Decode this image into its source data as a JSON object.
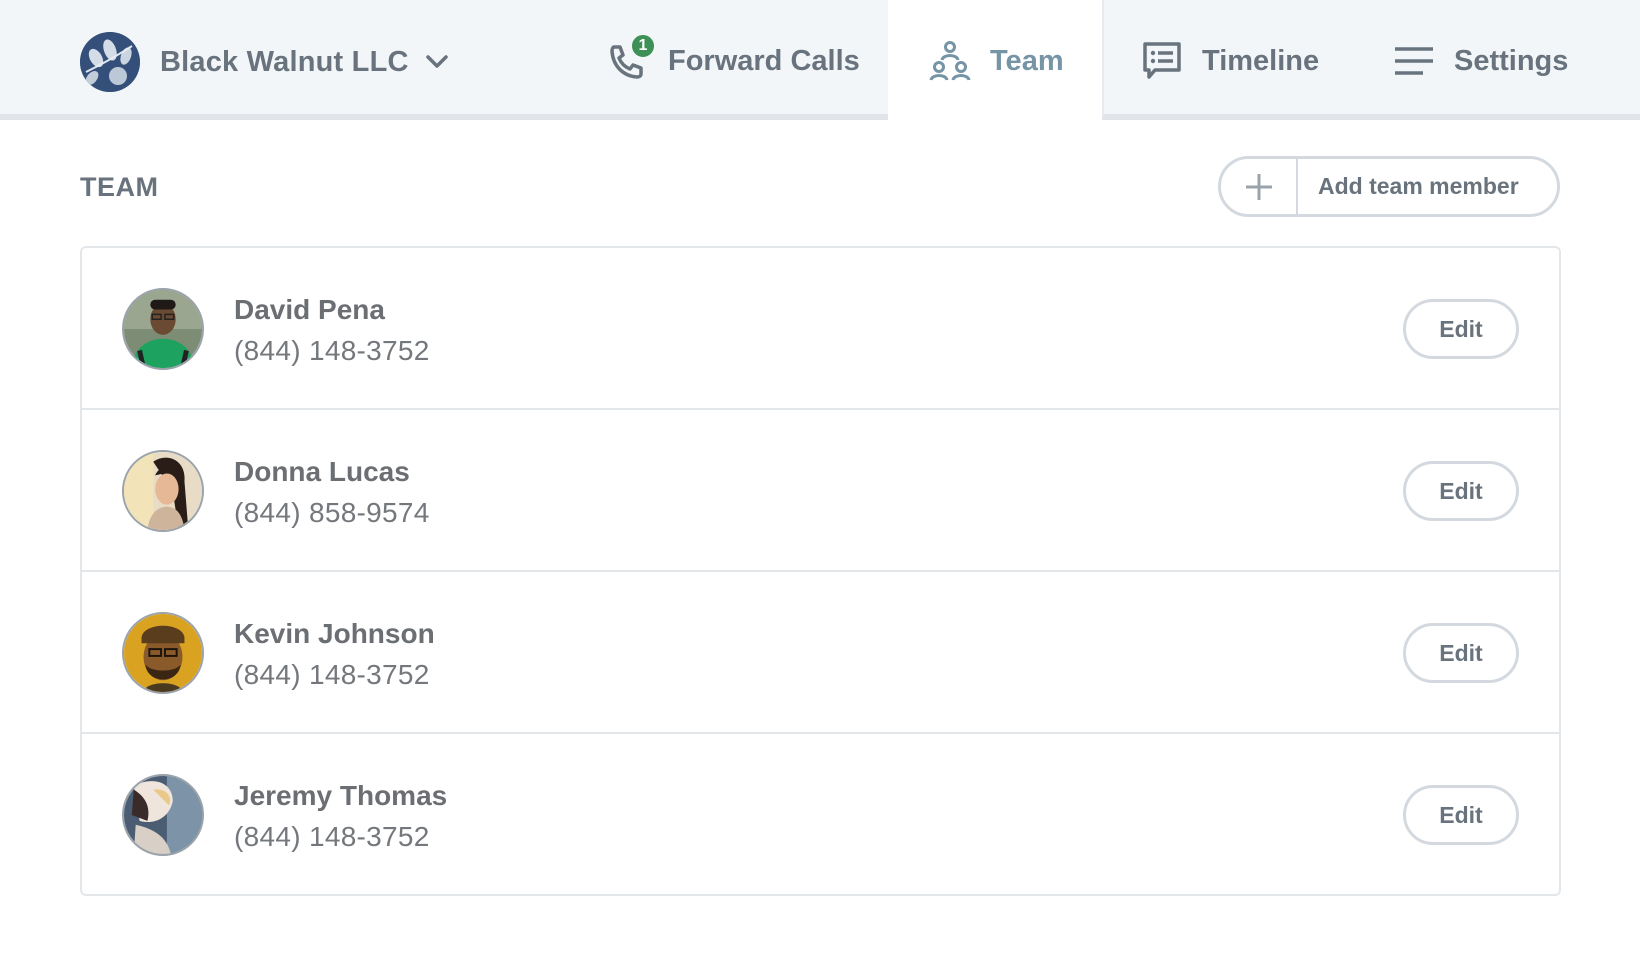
{
  "header": {
    "company_name": "Black Walnut LLC",
    "nav": [
      {
        "label": "Forward Calls",
        "icon": "phone-forward-icon",
        "badge": "1",
        "active": false
      },
      {
        "label": "Team",
        "icon": "team-icon",
        "active": true
      },
      {
        "label": "Timeline",
        "icon": "timeline-chat-icon",
        "active": false
      },
      {
        "label": "Settings",
        "icon": "settings-menu-icon",
        "active": false
      }
    ]
  },
  "colors": {
    "accent_active": "#7594a6",
    "text_muted": "#68737e",
    "badge_green": "#3d9157",
    "brand_logo": "#34507a",
    "nav_bg": "#f2f6f9",
    "border": "#d3d9de"
  },
  "team": {
    "title": "TEAM",
    "add_button_label": "Add team member",
    "members": [
      {
        "name": "David Pena",
        "phone": "(844) 148-3752",
        "edit_label": "Edit"
      },
      {
        "name": "Donna Lucas",
        "phone": "(844) 858-9574",
        "edit_label": "Edit"
      },
      {
        "name": "Kevin Johnson",
        "phone": "(844) 148-3752",
        "edit_label": "Edit"
      },
      {
        "name": "Jeremy Thomas",
        "phone": "(844) 148-3752",
        "edit_label": "Edit"
      }
    ]
  }
}
